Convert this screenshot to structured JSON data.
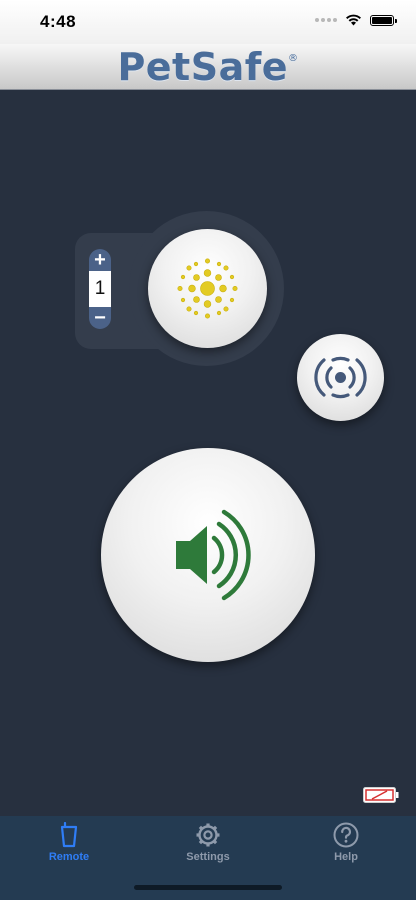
{
  "status_bar": {
    "time": "4:48"
  },
  "header": {
    "logo_text": "PetSafe",
    "registered_mark": "®"
  },
  "remote": {
    "vibration_level": "1",
    "stepper_plus": "+",
    "stepper_minus": "−",
    "icons": {
      "vibrate": "sunburst-icon",
      "tone": "radar-waves-icon",
      "static": "speaker-sound-icon",
      "battery": "low-battery-icon"
    }
  },
  "tabbar": {
    "tabs": [
      {
        "label": "Remote",
        "icon": "remote-icon",
        "active": true
      },
      {
        "label": "Settings",
        "icon": "gear-icon",
        "active": false
      },
      {
        "label": "Help",
        "icon": "question-icon",
        "active": false
      }
    ]
  },
  "colors": {
    "background": "#27303f",
    "vibrate_icon": "#e3cb23",
    "static_icon": "#2e7a3a",
    "tone_icon": "#45597a",
    "active_tab": "#2f7df6",
    "inactive_tab": "#8e9aab",
    "battery_low": "#d63030"
  }
}
